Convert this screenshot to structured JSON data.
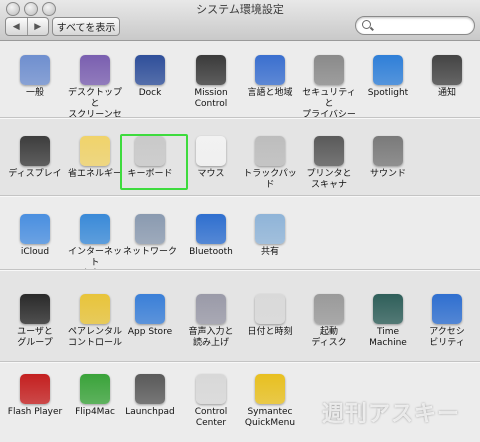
{
  "window": {
    "title": "システム環境設定"
  },
  "toolbar": {
    "back": "◀",
    "forward": "▶",
    "show_all": "すべてを表示"
  },
  "search": {
    "placeholder": ""
  },
  "rows": [
    {
      "items": [
        {
          "label": "一般",
          "icon": "general-icon",
          "color": "#6f8fcf"
        },
        {
          "label": "デスクトップと\nスクリーンセーバ",
          "icon": "desktop-icon",
          "color": "#7a5fb0"
        },
        {
          "label": "Dock",
          "icon": "dock-icon",
          "color": "#2f4f9a"
        },
        {
          "label": "Mission\nControl",
          "icon": "mission-control-icon",
          "color": "#3a3a3a"
        },
        {
          "label": "言語と地域",
          "icon": "language-icon",
          "color": "#3a6fcf"
        },
        {
          "label": "セキュリティと\nプライバシー",
          "icon": "security-icon",
          "color": "#8a8a8a"
        },
        {
          "label": "Spotlight",
          "icon": "spotlight-icon",
          "color": "#2f7fd8"
        },
        {
          "label": "通知",
          "icon": "notifications-icon",
          "color": "#444444"
        }
      ]
    },
    {
      "items": [
        {
          "label": "ディスプレイ",
          "icon": "display-icon",
          "color": "#3d3d3d"
        },
        {
          "label": "省エネルギー",
          "icon": "energy-icon",
          "color": "#f0d36a"
        },
        {
          "label": "キーボード",
          "icon": "keyboard-icon",
          "color": "#c9c9c9"
        },
        {
          "label": "マウス",
          "icon": "mouse-icon",
          "color": "#f2f2f2"
        },
        {
          "label": "トラックパッド",
          "icon": "trackpad-icon",
          "color": "#bdbdbd"
        },
        {
          "label": "プリンタと\nスキャナ",
          "icon": "printer-icon",
          "color": "#5a5a5a"
        },
        {
          "label": "サウンド",
          "icon": "sound-icon",
          "color": "#7a7a7a"
        }
      ]
    },
    {
      "items": [
        {
          "label": "iCloud",
          "icon": "icloud-icon",
          "color": "#4a8fe0"
        },
        {
          "label": "インターネット\nアカウント",
          "icon": "internet-accounts-icon",
          "color": "#3a8ad8"
        },
        {
          "label": "ネットワーク",
          "icon": "network-icon",
          "color": "#8a9ab0"
        },
        {
          "label": "Bluetooth",
          "icon": "bluetooth-icon",
          "color": "#2f6fcf"
        },
        {
          "label": "共有",
          "icon": "sharing-icon",
          "color": "#8fb4d8"
        }
      ]
    },
    {
      "items": [
        {
          "label": "ユーザと\nグループ",
          "icon": "users-icon",
          "color": "#2a2a2a"
        },
        {
          "label": "ペアレンタル\nコントロール",
          "icon": "parental-controls-icon",
          "color": "#e8c43a"
        },
        {
          "label": "App Store",
          "icon": "app-store-icon",
          "color": "#3a7fd8"
        },
        {
          "label": "音声入力と\n読み上げ",
          "icon": "dictation-icon",
          "color": "#9a9aa8"
        },
        {
          "label": "日付と時刻",
          "icon": "date-time-icon",
          "color": "#d9d9d9"
        },
        {
          "label": "起動\nディスク",
          "icon": "startup-disk-icon",
          "color": "#9a9a9a"
        },
        {
          "label": "Time\nMachine",
          "icon": "time-machine-icon",
          "color": "#2f5f5a"
        },
        {
          "label": "アクセシ\nビリティ",
          "icon": "accessibility-icon",
          "color": "#2f6fd0"
        }
      ]
    },
    {
      "items": [
        {
          "label": "Flash Player",
          "icon": "flash-player-icon",
          "color": "#c42020"
        },
        {
          "label": "Flip4Mac",
          "icon": "flip4mac-icon",
          "color": "#3aa33a"
        },
        {
          "label": "Launchpad",
          "icon": "launchpad-icon",
          "color": "#5a5a5a"
        },
        {
          "label": "Control Center",
          "icon": "logicool-icon",
          "color": "#d8d8d8"
        },
        {
          "label": "Symantec\nQuickMenu",
          "icon": "symantec-icon",
          "color": "#e8c020"
        }
      ]
    }
  ],
  "watermark": "週刊アスキー"
}
